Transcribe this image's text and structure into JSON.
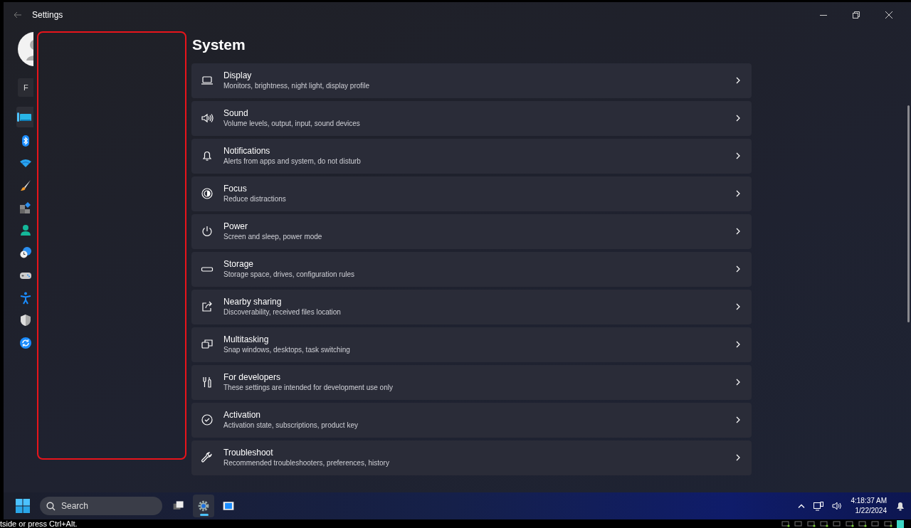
{
  "window": {
    "title": "Settings"
  },
  "profile": {
    "initial": "F"
  },
  "nav_items": [
    {
      "kind": "display",
      "selected": true
    },
    {
      "kind": "bluetooth",
      "selected": false
    },
    {
      "kind": "network",
      "selected": false
    },
    {
      "kind": "brush",
      "selected": false
    },
    {
      "kind": "apps",
      "selected": false
    },
    {
      "kind": "person",
      "selected": false
    },
    {
      "kind": "time",
      "selected": false
    },
    {
      "kind": "gamepad",
      "selected": false
    },
    {
      "kind": "accessibility",
      "selected": false
    },
    {
      "kind": "shield",
      "selected": false
    },
    {
      "kind": "update",
      "selected": false
    }
  ],
  "page_title": "System",
  "settings": [
    {
      "kind": "display",
      "title": "Display",
      "description": "Monitors, brightness, night light, display profile"
    },
    {
      "kind": "sound",
      "title": "Sound",
      "description": "Volume levels, output, input, sound devices"
    },
    {
      "kind": "bell",
      "title": "Notifications",
      "description": "Alerts from apps and system, do not disturb"
    },
    {
      "kind": "focus",
      "title": "Focus",
      "description": "Reduce distractions"
    },
    {
      "kind": "power",
      "title": "Power",
      "description": "Screen and sleep, power mode"
    },
    {
      "kind": "storage",
      "title": "Storage",
      "description": "Storage space, drives, configuration rules"
    },
    {
      "kind": "share",
      "title": "Nearby sharing",
      "description": "Discoverability, received files location"
    },
    {
      "kind": "windows",
      "title": "Multitasking",
      "description": "Snap windows, desktops, task switching"
    },
    {
      "kind": "tools",
      "title": "For developers",
      "description": "These settings are intended for development use only"
    },
    {
      "kind": "check",
      "title": "Activation",
      "description": "Activation state, subscriptions, product key"
    },
    {
      "kind": "wrench",
      "title": "Troubleshoot",
      "description": "Recommended troubleshooters, preferences, history"
    }
  ],
  "taskbar": {
    "search_placeholder": "Search",
    "apps": [
      {
        "kind": "windows",
        "selected": false
      },
      {
        "kind": "gear",
        "selected": true
      },
      {
        "kind": "media",
        "selected": false
      }
    ],
    "time": "4:18:37 AM",
    "date": "1/22/2024"
  },
  "status_text": "tside or press Ctrl+Alt."
}
